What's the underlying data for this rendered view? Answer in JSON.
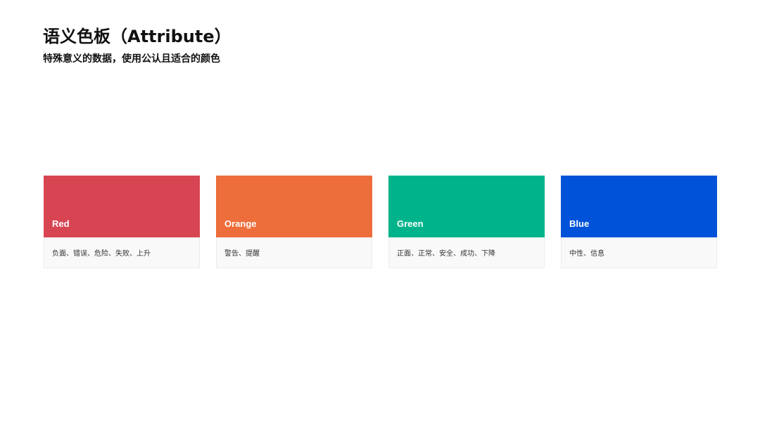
{
  "header": {
    "title": "语义色板（Attribute）",
    "subtitle": "特殊意义的数据，使用公认且适合的颜色"
  },
  "palette": [
    {
      "name": "Red",
      "color": "#d84552",
      "usage": "负面、错误、危险、失败、上升"
    },
    {
      "name": "Orange",
      "color": "#ed6e3a",
      "usage": "警告、提醒"
    },
    {
      "name": "Green",
      "color": "#00b38b",
      "usage": "正面、正常、安全、成功、下降"
    },
    {
      "name": "Blue",
      "color": "#0052d9",
      "usage": "中性、信息"
    }
  ]
}
